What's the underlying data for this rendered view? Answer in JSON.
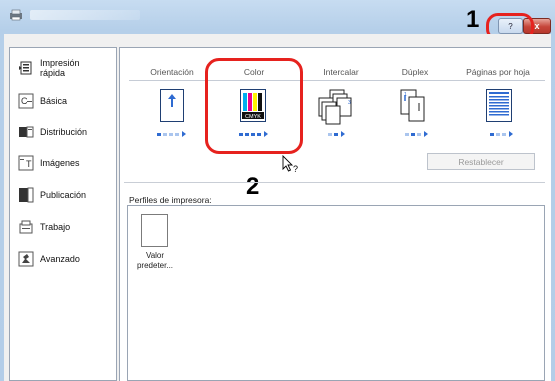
{
  "callouts": [
    "1",
    "2"
  ],
  "window": {
    "help_glyph": "?",
    "close_glyph": "x"
  },
  "sidebar": {
    "items": [
      {
        "label": "Impresión rápida",
        "icon": "quick-print-icon"
      },
      {
        "label": "Básica",
        "icon": "basic-icon"
      },
      {
        "label": "Distribución",
        "icon": "layout-icon"
      },
      {
        "label": "Imágenes",
        "icon": "imaging-icon"
      },
      {
        "label": "Publicación",
        "icon": "publishing-icon"
      },
      {
        "label": "Trabajo",
        "icon": "job-icon"
      },
      {
        "label": "Avanzado",
        "icon": "advanced-icon"
      }
    ]
  },
  "quick_print": {
    "columns": [
      {
        "label": "Orientación",
        "icon": "orientation-portrait-icon"
      },
      {
        "label": "Color",
        "icon": "color-cmyk-icon",
        "icon_text": "CMYK"
      },
      {
        "label": "Intercalar",
        "icon": "collate-icon"
      },
      {
        "label": "Dúplex",
        "icon": "duplex-icon"
      },
      {
        "label": "Páginas por hoja",
        "icon": "pages-per-sheet-icon"
      }
    ],
    "reset_label": "Restablecer"
  },
  "profiles": {
    "label": "Perfiles de impresora:",
    "items": [
      {
        "label": "Valor predeter...",
        "icon": "document-icon"
      }
    ]
  },
  "colors": {
    "accent": "#2f6bd1",
    "callout": "#e6221e"
  }
}
